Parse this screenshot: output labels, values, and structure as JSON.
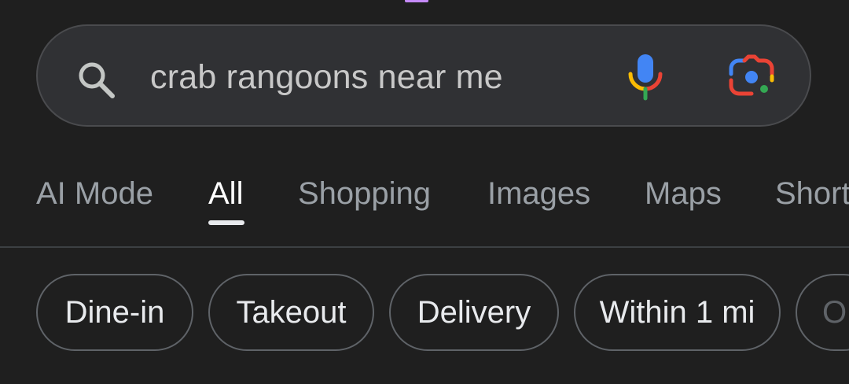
{
  "search": {
    "query": "crab rangoons near me"
  },
  "icons": {
    "search": "search-icon",
    "mic": "microphone-icon",
    "lens": "google-lens-icon"
  },
  "colors": {
    "background": "#1f1f1f",
    "search_bar": "#303134",
    "active_tab": "#ffffff",
    "inactive_tab": "#9aa0a6",
    "google_blue": "#4285f4",
    "google_red": "#ea4335",
    "google_yellow": "#fbbc04",
    "google_green": "#34a853"
  },
  "tabs": [
    {
      "label": "AI Mode",
      "active": false
    },
    {
      "label": "All",
      "active": true
    },
    {
      "label": "Shopping",
      "active": false
    },
    {
      "label": "Images",
      "active": false
    },
    {
      "label": "Maps",
      "active": false
    },
    {
      "label": "Short",
      "active": false
    }
  ],
  "chips": [
    {
      "label": "Dine-in"
    },
    {
      "label": "Takeout"
    },
    {
      "label": "Delivery"
    },
    {
      "label": "Within 1 mi"
    },
    {
      "label": "O"
    }
  ]
}
